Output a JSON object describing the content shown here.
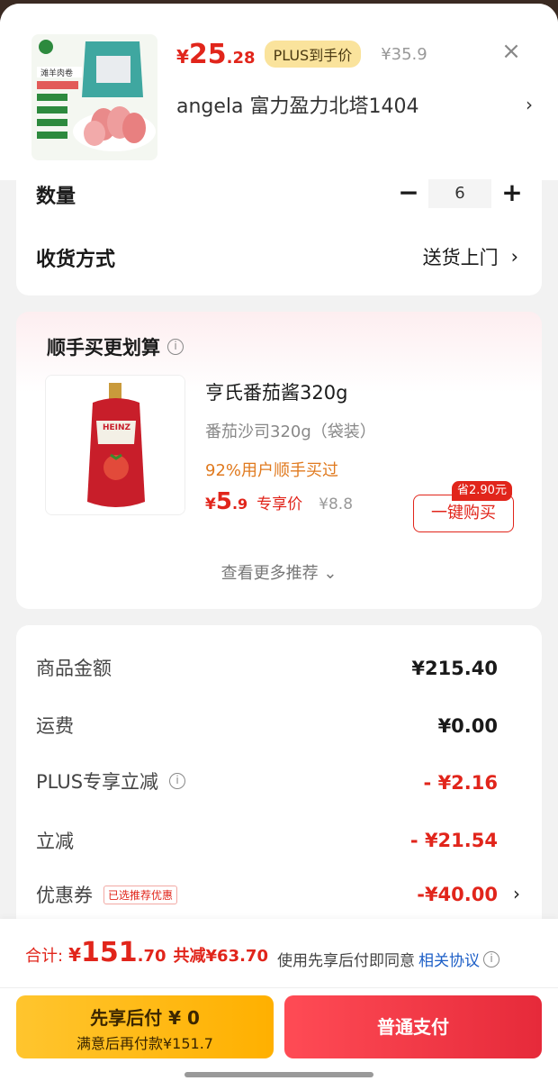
{
  "header": {
    "price_currency": "¥",
    "price_int": "25",
    "price_dec": ".28",
    "plus_badge": "PLUS到手价",
    "original_price": "¥35.9",
    "close_label": "×",
    "address": "angela  富力盈力北塔1404",
    "thumb_title": "滩羊肉卷"
  },
  "order": {
    "quantity_label": "数量",
    "quantity_value": "6",
    "minus_label": "−",
    "plus_label": "+",
    "delivery_label": "收货方式",
    "delivery_value": "送货上门"
  },
  "recommend": {
    "title": "顺手买更划算",
    "product_name": "亨氏番茄酱320g",
    "product_spec": "番茄沙司320g（袋装）",
    "bought_note": "92%用户顺手买过",
    "price_currency": "¥",
    "price_int": "5",
    "price_dec": ".9",
    "price_tag": "专享价",
    "original_price": "¥8.8",
    "save_badge": "省2.90元",
    "buy_button": "一键购买",
    "more_link": "查看更多推荐 ⌄",
    "brand": "HEINZ"
  },
  "summary": {
    "items": [
      {
        "label": "商品金额",
        "value": "¥215.40"
      },
      {
        "label": "运费",
        "value": "¥0.00"
      },
      {
        "label": "PLUS专享立减",
        "value": "- ¥2.16"
      },
      {
        "label": "立减",
        "value": "- ¥21.54"
      },
      {
        "label": "优惠券",
        "tag": "已选推荐优惠",
        "value": "-¥40.00"
      }
    ]
  },
  "footer": {
    "total_label": "合计:",
    "total_currency": "¥",
    "total_int": "151",
    "total_dec": ".70",
    "saved": "共减¥63.70",
    "agree_prefix": "使用先享后付即同意",
    "agree_link": "相关协议",
    "pay_later_main": "先享后付 ¥ 0",
    "pay_later_sub": "满意后再付款¥151.7",
    "pay_normal": "普通支付"
  },
  "colors": {
    "accent_red": "#e1251b",
    "plus_gold": "#fae39c",
    "pay_later_yellow": "#ffc52e",
    "link_blue": "#1d5fc7"
  }
}
